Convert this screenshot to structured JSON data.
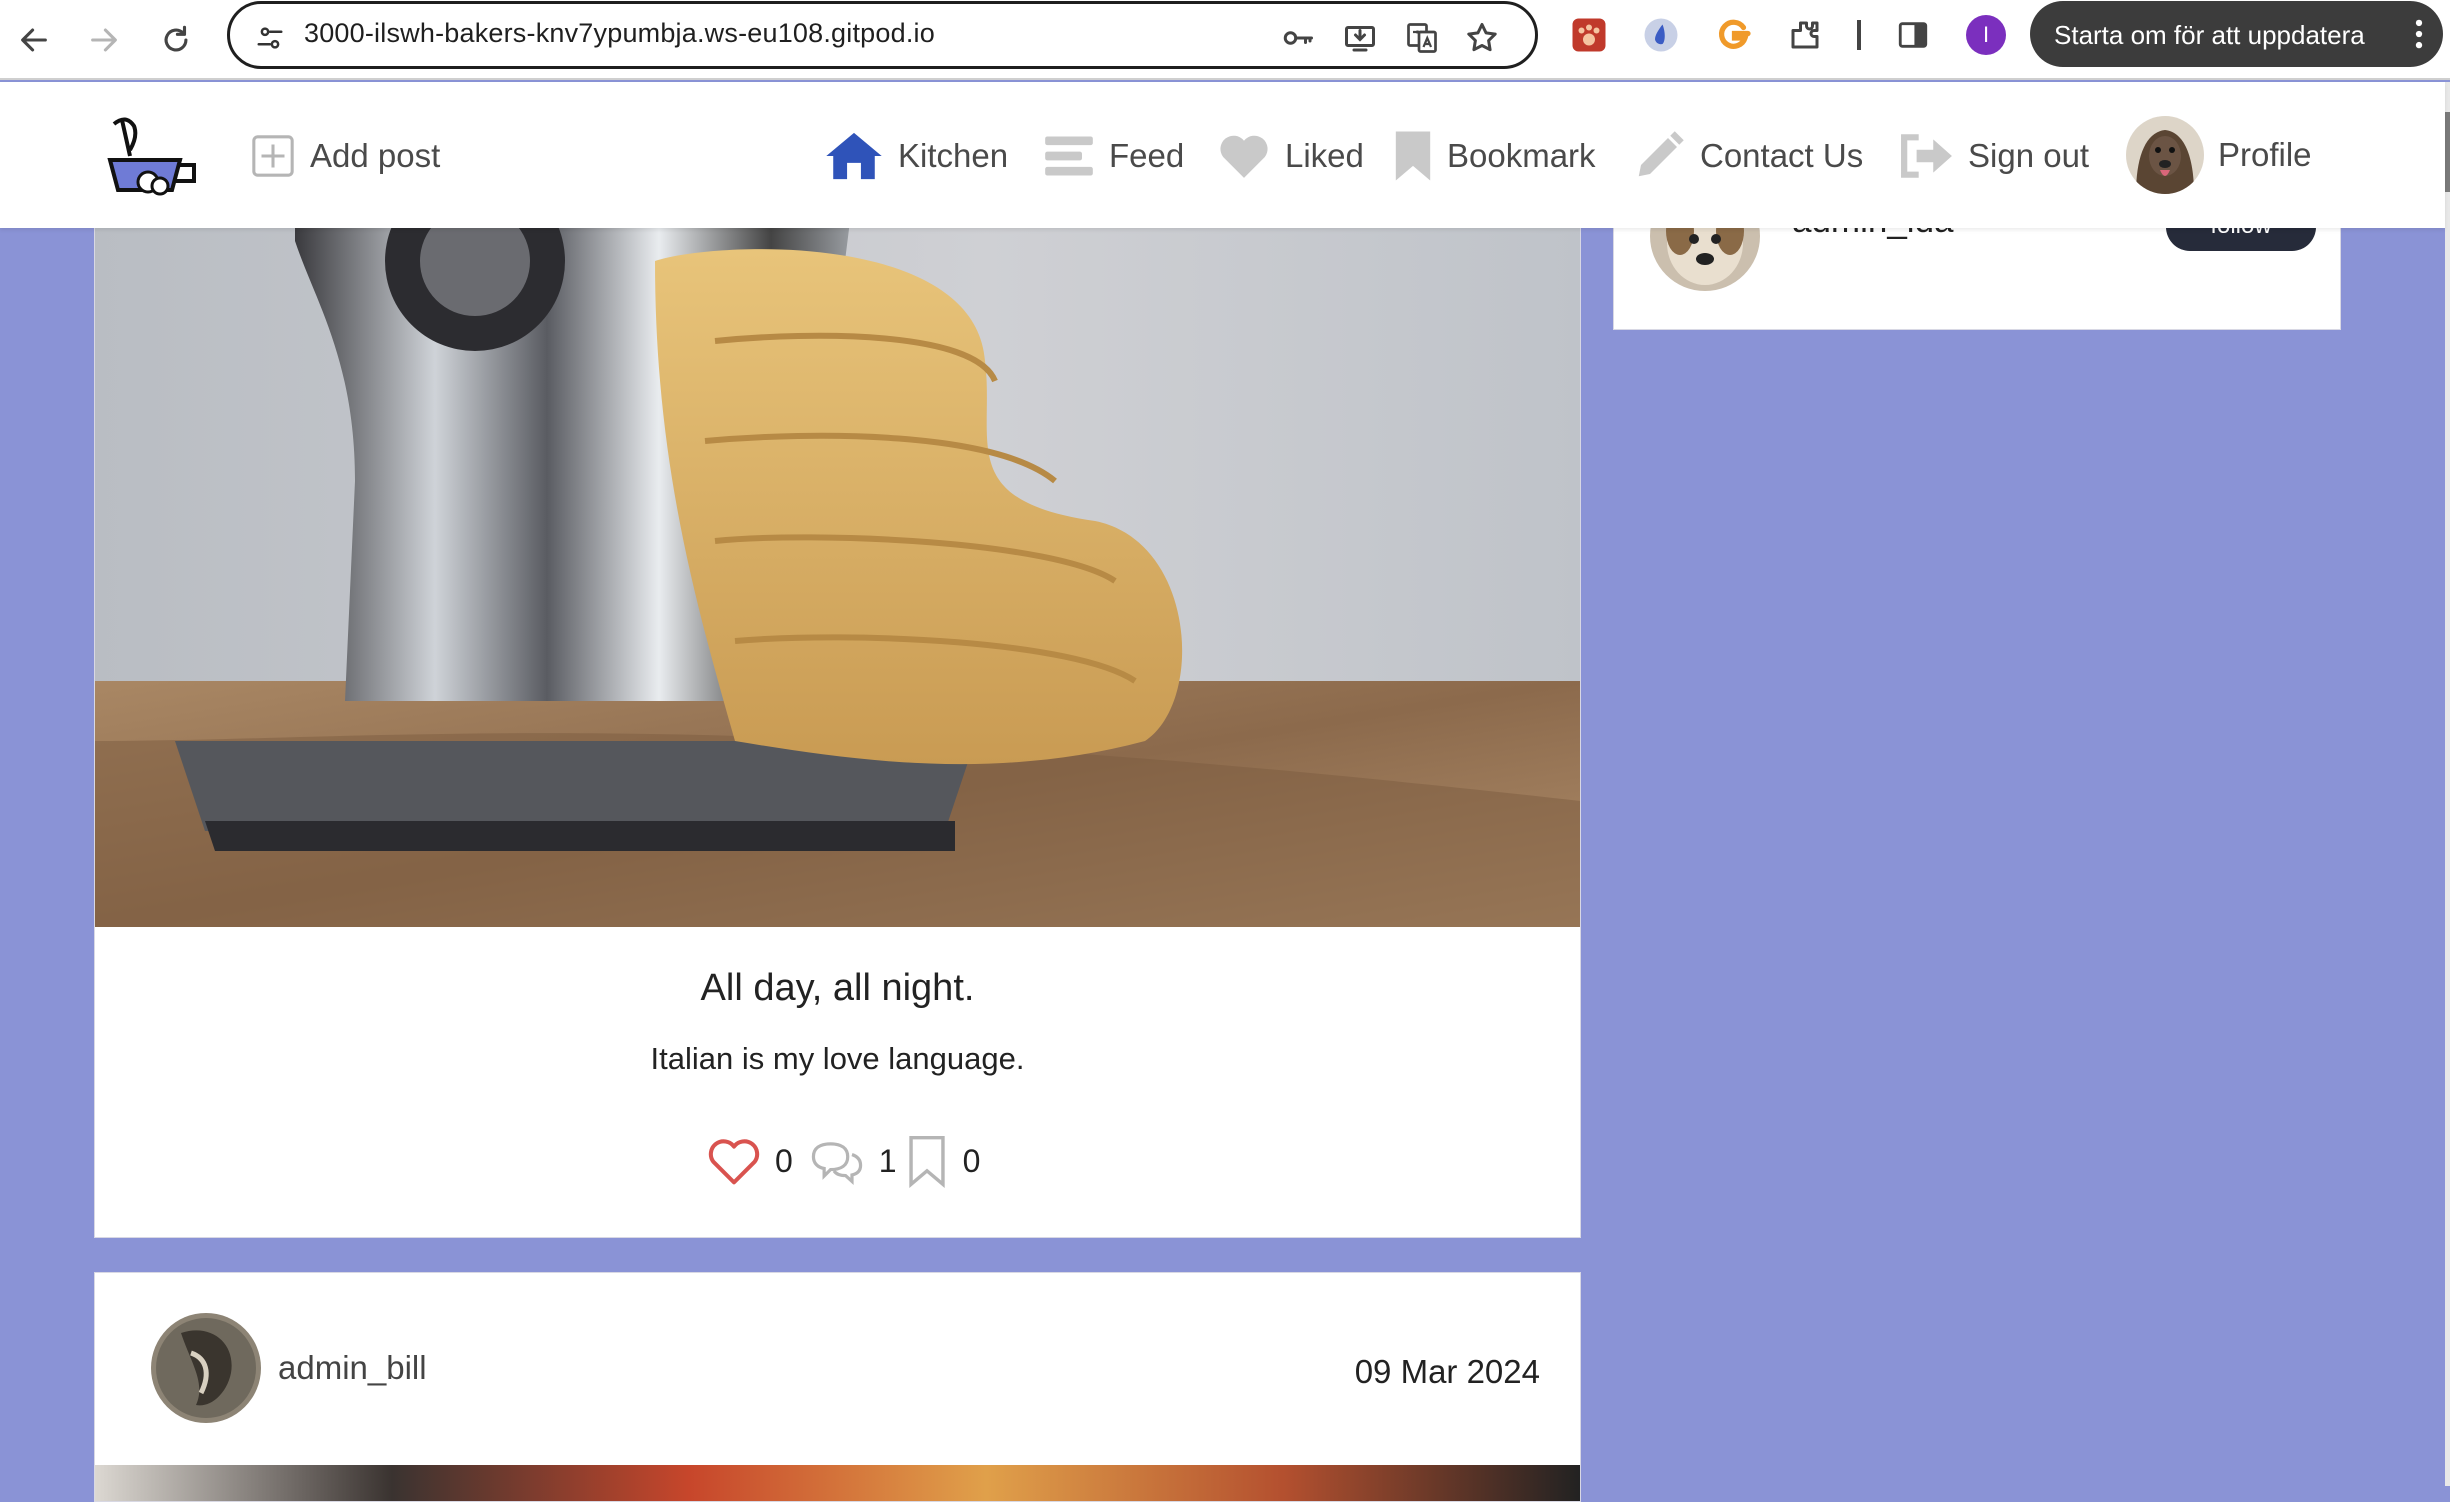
{
  "browser": {
    "url": "3000-ilswh-bakers-knv7ypumbja.ws-eu108.gitpod.io",
    "profile_initial": "I",
    "update_label": "Starta om för att uppdatera",
    "colors": {
      "profile": "#7b2fbe",
      "pill": "#3c3c3c"
    }
  },
  "header": {
    "add_post_label": "Add post",
    "nav": {
      "kitchen": "Kitchen",
      "feed": "Feed",
      "liked": "Liked",
      "bookmark": "Bookmark",
      "contact": "Contact Us",
      "signout": "Sign out",
      "profile": "Profile"
    },
    "colors": {
      "kitchen_icon": "#2f53b9",
      "nav_icon": "#c9c9c9",
      "text": "#4a4a4a"
    }
  },
  "sidebar": {
    "user_name": "admin_ida",
    "follow_label": "follow"
  },
  "posts": [
    {
      "title": "All day, all night.",
      "body": "Italian is my love language.",
      "likes": "0",
      "comments": "1",
      "bookmarks": "0",
      "colors": {
        "heart": "#d9534f"
      }
    },
    {
      "author": "admin_bill",
      "date": "09 Mar 2024"
    }
  ],
  "page": {
    "background": "#8a93d6"
  }
}
